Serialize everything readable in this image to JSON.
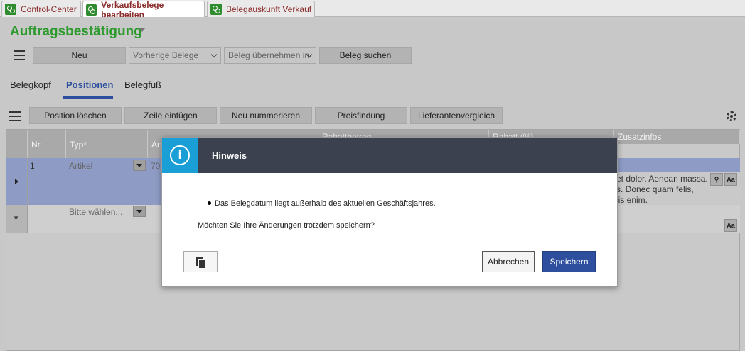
{
  "tabs": [
    {
      "label": "Control-Center"
    },
    {
      "label": "Verkaufsbelege bearbeiten"
    },
    {
      "label": "Belegauskunft Verkauf"
    }
  ],
  "header": {
    "title": "Auftragsbestätigung",
    "toolbar": {
      "new_label": "Neu",
      "previous_label": "Vorherige Belege",
      "take_over_label": "Beleg übernehmen in",
      "search_label": "Beleg suchen"
    }
  },
  "subtabs": [
    {
      "label": "Belegkopf"
    },
    {
      "label": "Positionen"
    },
    {
      "label": "Belegfuß"
    }
  ],
  "positions_toolbar": {
    "delete_label": "Position löschen",
    "insert_label": "Zeile einfügen",
    "renumber_label": "Neu nummerieren",
    "pricing_label": "Preisfindung",
    "supplier_label": "Lieferantenvergleich"
  },
  "grid": {
    "columns": {
      "nr": "Nr.",
      "typ": "Typ*",
      "art": "Art",
      "rabattbetrag": "Rabattbetrag",
      "rabatt_pct": "Rabatt (%)",
      "zusatzinfos": "Zusatzinfos"
    },
    "row1": {
      "nr": "1",
      "typ": "Artikel",
      "art": "700",
      "text_line1": "et dolor. Aenean massa.",
      "text_line2": "s. Donec quam felis,",
      "text_line3": "lis enim."
    },
    "new_row": {
      "typ_placeholder": "Bitte wählen..."
    },
    "font_button_label": "Aa"
  },
  "modal": {
    "title": "Hinweis",
    "bullet_message": "Das Belegdatum liegt außerhalb des aktuellen Geschäftsjahres.",
    "question": "Möchten Sie Ihre Änderungen trotzdem speichern?",
    "cancel_label": "Abbrechen",
    "save_label": "Speichern"
  },
  "colors": {
    "accent_green": "#2d9a2d",
    "accent_blue": "#2d4f9e",
    "modal_header": "#3c4150",
    "info_blue": "#1a9ed6",
    "selected_row": "#8e9cc5"
  }
}
